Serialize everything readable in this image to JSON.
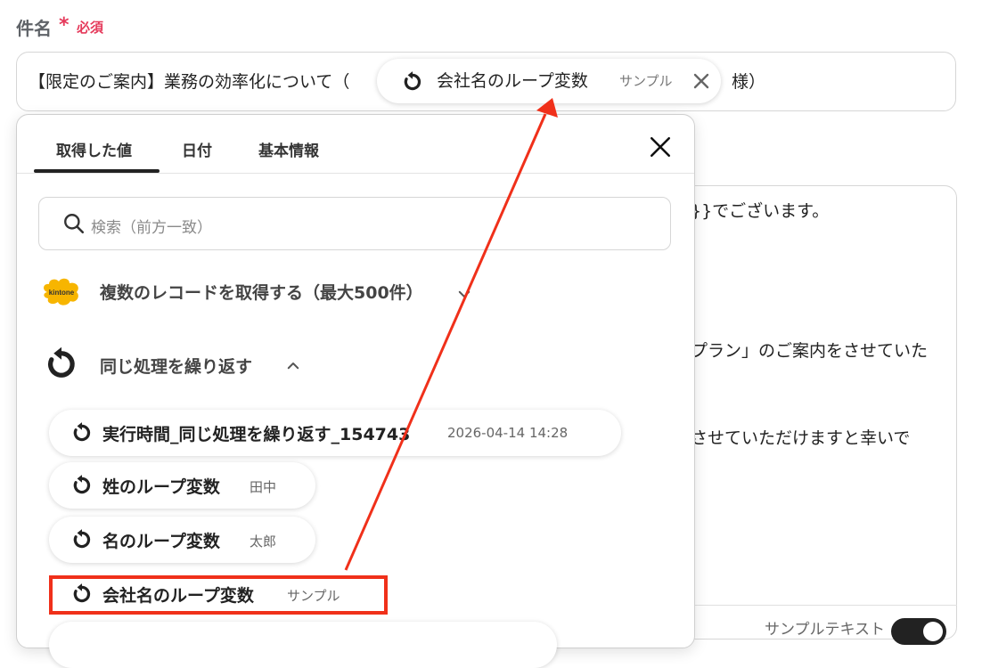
{
  "subject": {
    "label": "件名",
    "required_mark": "*",
    "required_text": "必須",
    "prefix": "【限定のご案内】業務の効率化について（",
    "suffix": "様）",
    "chip": {
      "label": "会社名のループ変数",
      "sample": "サンプル",
      "icon": "loop-icon"
    }
  },
  "body_fragments": [
    "}}でございます。",
    "プラン」のご案内をさせていた",
    "させていただけますと幸いで"
  ],
  "body_footer": "サンプルテキスト",
  "dropdown": {
    "tabs": [
      "取得した値",
      "日付",
      "基本情報"
    ],
    "active_tab": 0,
    "search_placeholder": "検索（前方一致）",
    "groups": [
      {
        "label": "複数のレコードを取得する（最大500件）",
        "icon": "kintone-logo",
        "chevron": "down"
      },
      {
        "label": "同じ処理を繰り返す",
        "icon": "loop-icon",
        "chevron": "up"
      }
    ],
    "items": [
      {
        "label": "実行時間_同じ処理を繰り返す_154743",
        "sample": "2026-04-14 14:28"
      },
      {
        "label": "姓のループ変数",
        "sample": "田中"
      },
      {
        "label": "名のループ変数",
        "sample": "太郎"
      },
      {
        "label": "会社名のループ変数",
        "sample": "サンプル",
        "highlighted": true
      }
    ]
  },
  "colors": {
    "required": "#e53a5b",
    "annotation": "#f0301a",
    "kintone": "#f7b500"
  }
}
